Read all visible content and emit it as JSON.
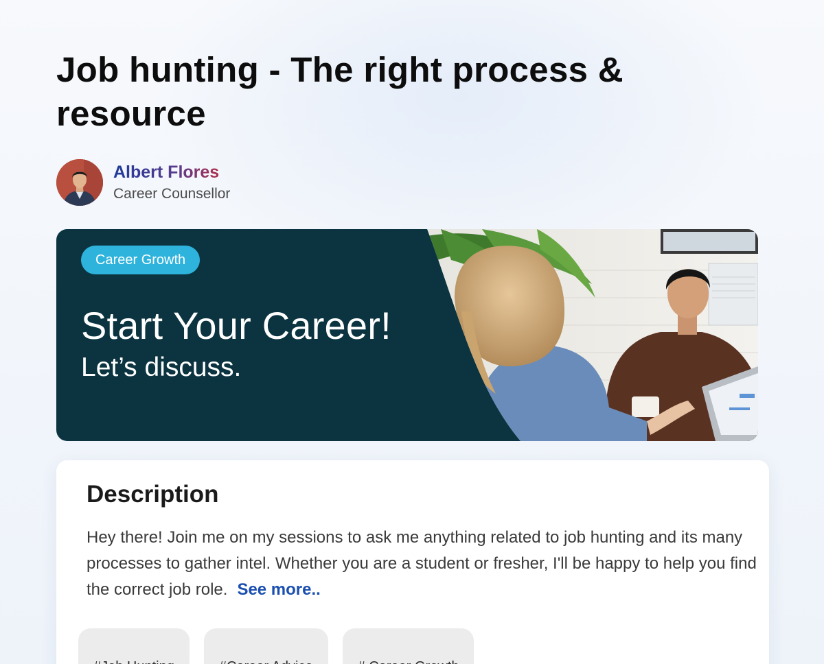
{
  "post": {
    "title": "Job hunting - The right process & resource"
  },
  "author": {
    "name": "Albert Flores",
    "role": "Career Counsellor"
  },
  "banner": {
    "chip": "Career Growth",
    "headline": "Start Your Career!",
    "subheadline": "Let’s discuss."
  },
  "description": {
    "heading": "Description",
    "body": "Hey there! Join me on my sessions to ask me anything related to job hunting and its many processes to gather intel. Whether you are a student or fresher, I'll be happy to help you find the correct job role.",
    "see_more": "See more.."
  },
  "tags": [
    "#Job Hunting",
    "#Career Advice",
    "# Career Growth"
  ],
  "colors": {
    "banner_bg": "#0b3440",
    "chip_bg": "#2eb3dc",
    "link": "#1a4fb0"
  }
}
